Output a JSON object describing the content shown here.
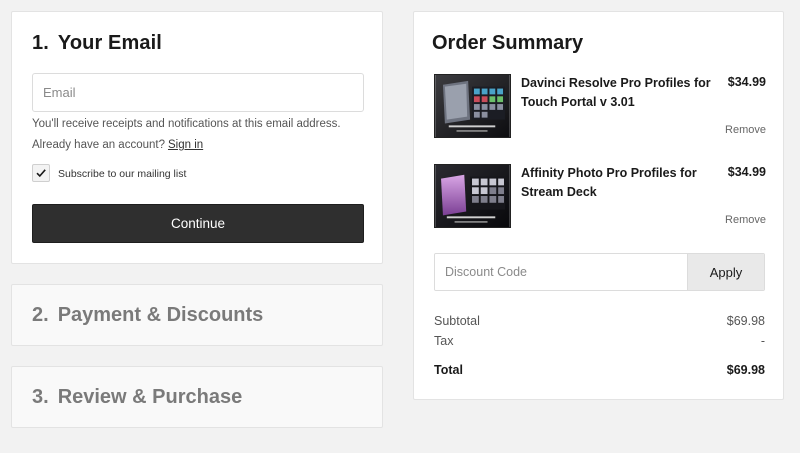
{
  "steps": {
    "email": {
      "number": "1.",
      "title": "Your Email",
      "email_placeholder": "Email",
      "note": "You'll receive receipts and notifications at this email address.",
      "account_prompt": "Already have an account?",
      "sign_in_label": "Sign in",
      "subscribe_label": "Subscribe to our mailing list",
      "subscribe_checked": true,
      "continue_label": "Continue"
    },
    "payment": {
      "number": "2.",
      "title": "Payment & Discounts"
    },
    "review": {
      "number": "3.",
      "title": "Review & Purchase"
    }
  },
  "summary": {
    "title": "Order Summary",
    "items": [
      {
        "name": "Davinci Resolve Pro Profiles for Touch Portal v 3.01",
        "price": "$34.99",
        "remove_label": "Remove",
        "thumb_icon": "davinci-profiles-thumbnail"
      },
      {
        "name": "Affinity Photo Pro Profiles for Stream Deck",
        "price": "$34.99",
        "remove_label": "Remove",
        "thumb_icon": "affinity-profiles-thumbnail"
      }
    ],
    "discount_placeholder": "Discount Code",
    "apply_label": "Apply",
    "subtotal_label": "Subtotal",
    "subtotal_value": "$69.98",
    "tax_label": "Tax",
    "tax_value": "-",
    "total_label": "Total",
    "total_value": "$69.98"
  },
  "colors": {
    "page_bg": "#f2f2f2",
    "button_dark": "#2f2f2f",
    "muted_text": "#7a7a7a"
  }
}
